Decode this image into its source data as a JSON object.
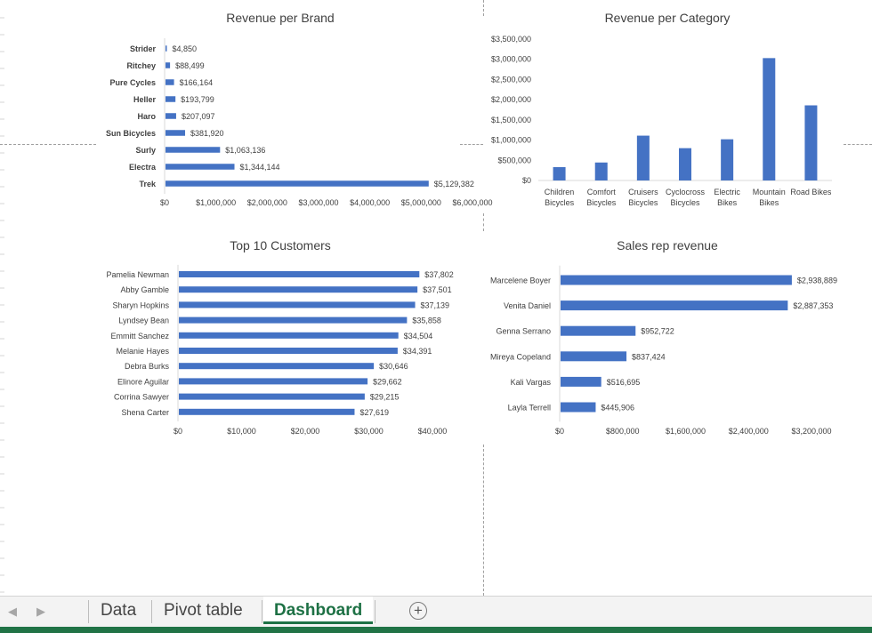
{
  "colors": {
    "bar": "#4472c4",
    "accent": "#217346",
    "active_tab": "#1e7145"
  },
  "charts": {
    "brand": {
      "chart_data": {
        "type": "bar",
        "orientation": "horizontal",
        "title": "Revenue per Brand",
        "categories": [
          "Strider",
          "Ritchey",
          "Pure Cycles",
          "Heller",
          "Haro",
          "Sun Bicycles",
          "Surly",
          "Electra",
          "Trek"
        ],
        "values": [
          4850,
          88499,
          166164,
          193799,
          207097,
          381920,
          1063136,
          1344144,
          5129382
        ],
        "data_labels": [
          "$4,850",
          "$88,499",
          "$166,164",
          "$193,799",
          "$207,097",
          "$381,920",
          "$1,063,136",
          "$1,344,144",
          "$5,129,382"
        ],
        "axis_ticks": [
          "$0",
          "$1,000,000",
          "$2,000,000",
          "$3,000,000",
          "$4,000,000",
          "$5,000,000",
          "$6,000,000"
        ],
        "xlim": [
          0,
          6000000
        ],
        "grid": false,
        "legend": false
      }
    },
    "category": {
      "chart_data": {
        "type": "bar",
        "orientation": "vertical",
        "title": "Revenue per Category",
        "categories": [
          [
            "Children",
            "Bicycles"
          ],
          [
            "Comfort",
            "Bicycles"
          ],
          [
            "Cruisers",
            "Bicycles"
          ],
          [
            "Cyclocross",
            "Bicycles"
          ],
          [
            "Electric",
            "Bikes"
          ],
          [
            "Mountain",
            "Bikes"
          ],
          [
            "Road Bikes"
          ]
        ],
        "values": [
          330000,
          445000,
          1110000,
          800000,
          1020000,
          3030000,
          1860000
        ],
        "axis_ticks": [
          "$0",
          "$500,000",
          "$1,000,000",
          "$1,500,000",
          "$2,000,000",
          "$2,500,000",
          "$3,000,000",
          "$3,500,000"
        ],
        "ylim": [
          0,
          3500000
        ],
        "grid": false,
        "legend": false
      }
    },
    "customers": {
      "chart_data": {
        "type": "bar",
        "orientation": "horizontal",
        "title": "Top 10 Customers",
        "categories": [
          "Pamelia Newman",
          "Abby Gamble",
          "Sharyn Hopkins",
          "Lyndsey Bean",
          "Emmitt Sanchez",
          "Melanie Hayes",
          "Debra Burks",
          "Elinore Aguilar",
          "Corrina Sawyer",
          "Shena Carter"
        ],
        "values": [
          37802,
          37501,
          37139,
          35858,
          34504,
          34391,
          30646,
          29662,
          29215,
          27619
        ],
        "data_labels": [
          "$37,802",
          "$37,501",
          "$37,139",
          "$35,858",
          "$34,504",
          "$34,391",
          "$30,646",
          "$29,662",
          "$29,215",
          "$27,619"
        ],
        "axis_ticks": [
          "$0",
          "$10,000",
          "$20,000",
          "$30,000",
          "$40,000"
        ],
        "xlim": [
          0,
          40000
        ],
        "grid": false,
        "legend": false
      }
    },
    "salesrep": {
      "chart_data": {
        "type": "bar",
        "orientation": "horizontal",
        "title": "Sales rep revenue",
        "categories": [
          "Marcelene Boyer",
          "Venita Daniel",
          "Genna Serrano",
          "Mireya Copeland",
          "Kali Vargas",
          "Layla Terrell"
        ],
        "values": [
          2938889,
          2887353,
          952722,
          837424,
          516695,
          445906
        ],
        "data_labels": [
          "$2,938,889",
          "$2,887,353",
          "$952,722",
          "$837,424",
          "$516,695",
          "$445,906"
        ],
        "axis_ticks": [
          "$0",
          "$800,000",
          "$1,600,000",
          "$2,400,000",
          "$3,200,000"
        ],
        "xlim": [
          0,
          3200000
        ],
        "grid": false,
        "legend": false
      }
    }
  },
  "sheet_tabs": {
    "tabs": [
      "Data",
      "Pivot table",
      "Dashboard"
    ],
    "active": "Dashboard",
    "prev_icon": "◀",
    "next_icon": "▶",
    "add_icon": "+"
  }
}
